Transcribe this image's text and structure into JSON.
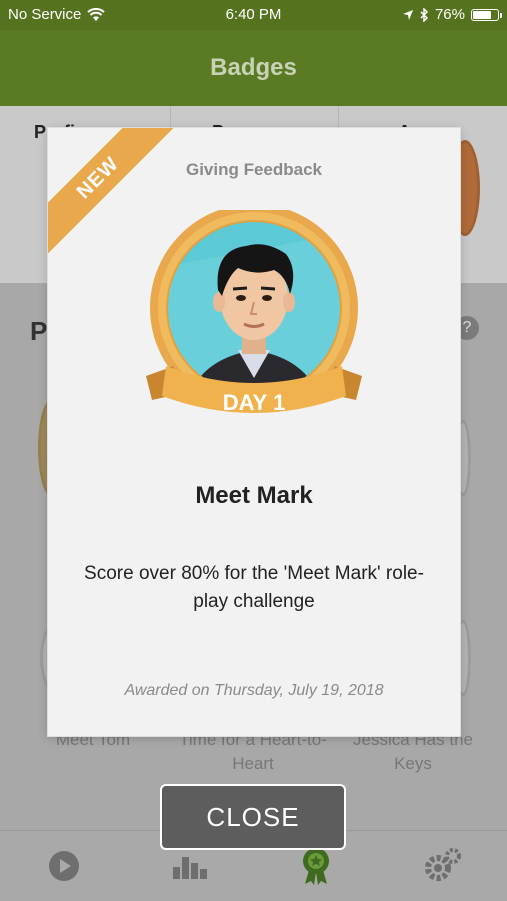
{
  "status_bar": {
    "carrier": "No Service",
    "time": "6:40 PM",
    "battery_percent": "76%",
    "battery_level": 0.76,
    "icons": [
      "wifi-icon",
      "location-icon",
      "bluetooth-icon",
      "battery-icon"
    ]
  },
  "nav": {
    "title": "Badges"
  },
  "modal": {
    "ribbon_text": "NEW",
    "category": "Giving Feedback",
    "badge_day": "DAY 1",
    "badge_name": "Meet Mark",
    "description": "Score over 80% for the 'Meet Mark' role-play challenge",
    "awarded": "Awarded on Thursday, July 19, 2018"
  },
  "background": {
    "tabs": [
      "Profi…",
      "P…",
      "A…"
    ],
    "section_heading": "P",
    "badge_labels": [
      "Meet Tom",
      "Time for a Heart-to-Heart",
      "Jessica Has the Keys"
    ]
  },
  "close_button": {
    "label": "CLOSE"
  },
  "tab_bar": {
    "items": [
      "play-icon",
      "bar-chart-icon",
      "badge-award-icon",
      "settings-gears-icon"
    ]
  },
  "colors": {
    "status_bar_bg": "#55721f",
    "nav_bg": "#5a7a24",
    "ribbon": "#e8a84b",
    "badge_gold": "#e8a84b",
    "badge_inner": "#5cc9d6",
    "active_tab": "#3f6b1f"
  }
}
